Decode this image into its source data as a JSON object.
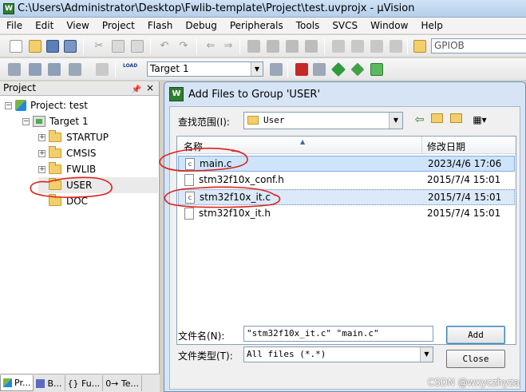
{
  "window": {
    "title": "C:\\Users\\Administrator\\Desktop\\Fwlib-template\\Project\\test.uvprojx - µVision",
    "logo": "W"
  },
  "menu": [
    "File",
    "Edit",
    "View",
    "Project",
    "Flash",
    "Debug",
    "Peripherals",
    "Tools",
    "SVCS",
    "Window",
    "Help"
  ],
  "toolbar": {
    "find_combo_value": "GPIOB",
    "target_combo_value": "Target 1",
    "load_label": "LOAD"
  },
  "project_panel": {
    "header": "Project",
    "pin_icon": "pin-icon",
    "close_glyph": "×",
    "tree": {
      "project": "Project: test",
      "target": "Target 1",
      "groups": [
        {
          "label": "STARTUP",
          "expander": "+"
        },
        {
          "label": "CMSIS",
          "expander": "+"
        },
        {
          "label": "FWLIB",
          "expander": "+"
        },
        {
          "label": "USER",
          "expander": ""
        },
        {
          "label": "DOC",
          "expander": ""
        }
      ]
    },
    "tabs": [
      "Pr...",
      "B...",
      "{} Fu...",
      "0→ Te..."
    ]
  },
  "dialog": {
    "title": "Add Files to Group 'USER'",
    "logo": "W",
    "look_in_label": "查找范围(I):",
    "look_in_value": "User",
    "columns": {
      "name": "名称",
      "date": "修改日期"
    },
    "files": [
      {
        "name": "main.c",
        "date": "2023/4/6 17:06",
        "icon": "c"
      },
      {
        "name": "stm32f10x_conf.h",
        "date": "2015/7/4 15:01",
        "icon": ""
      },
      {
        "name": "stm32f10x_it.c",
        "date": "2015/7/4 15:01",
        "icon": "c"
      },
      {
        "name": "stm32f10x_it.h",
        "date": "2015/7/4 15:01",
        "icon": ""
      }
    ],
    "filename_label": "文件名(N):",
    "filename_value": "\"stm32f10x_it.c\" \"main.c\"",
    "filetype_label": "文件类型(T):",
    "filetype_value": "All files (*.*)",
    "add_button": "Add",
    "close_button": "Close"
  },
  "colors": {
    "annotation_red": "#e0201a",
    "selection": "#cde4fb"
  },
  "watermark": "CSDN @wxyczhyza"
}
